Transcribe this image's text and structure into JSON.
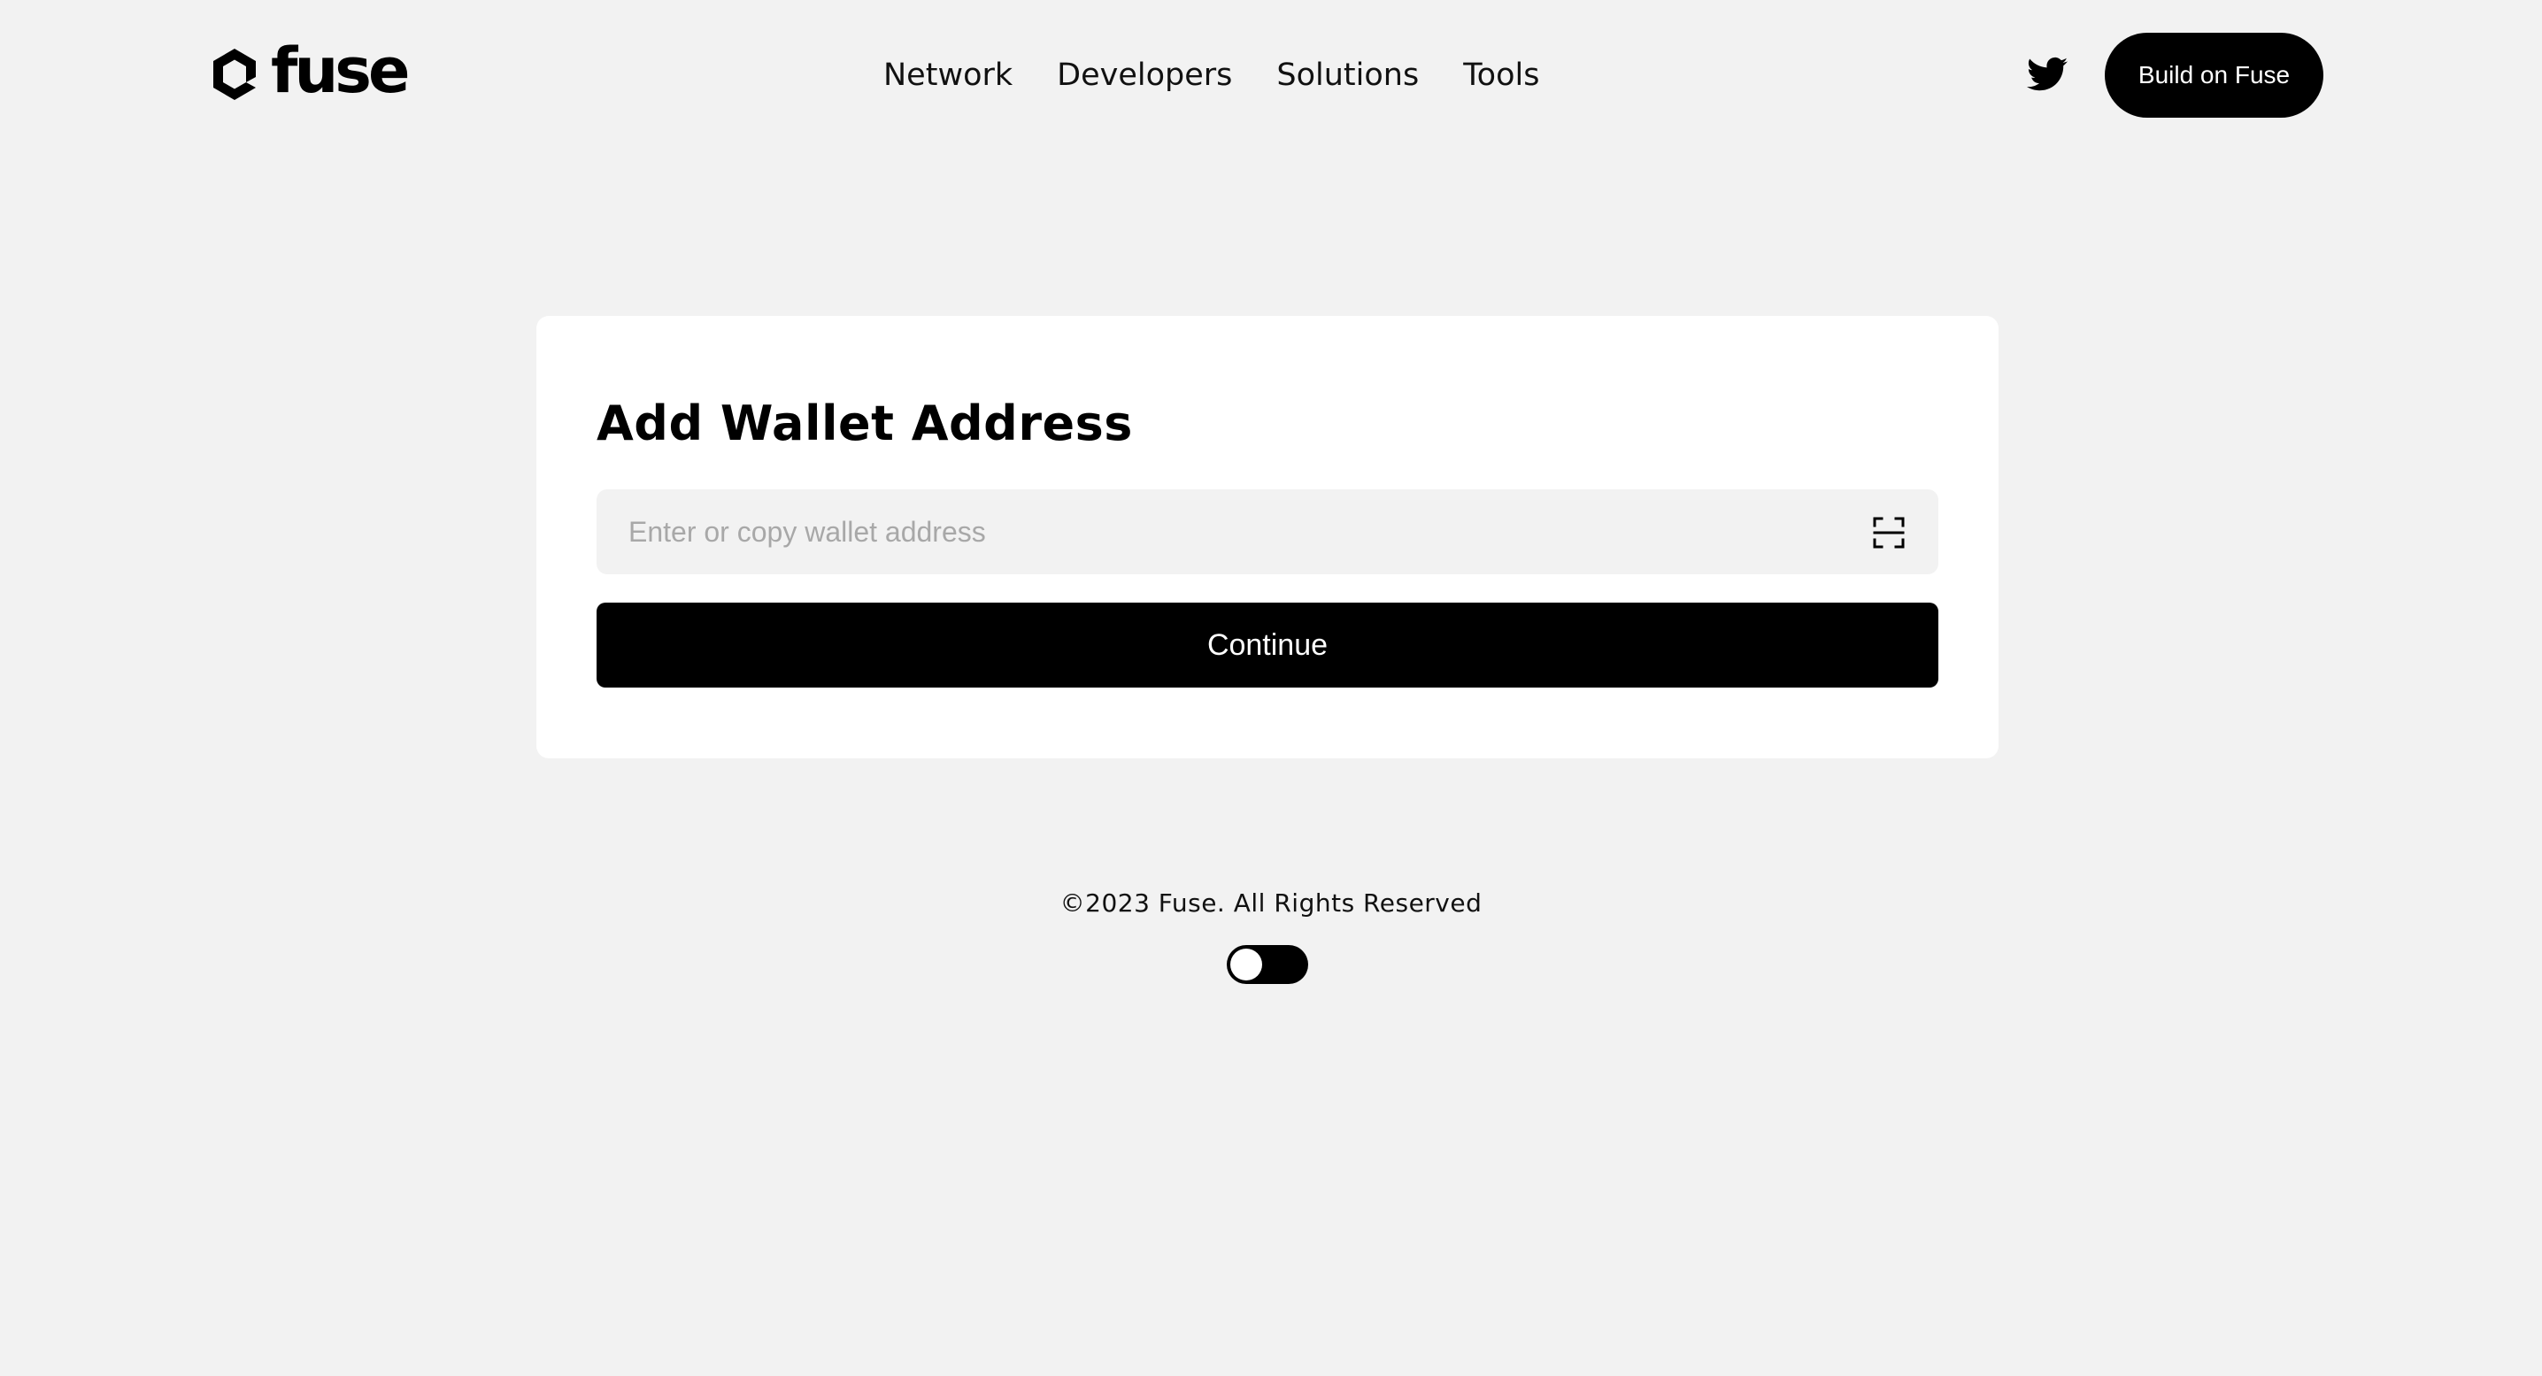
{
  "header": {
    "logo_text": "fuse",
    "nav": [
      {
        "label": "Network"
      },
      {
        "label": "Developers"
      },
      {
        "label": "Solutions"
      },
      {
        "label": "Tools"
      }
    ],
    "social_icon": "twitter-icon",
    "cta_label": "Build on Fuse"
  },
  "card": {
    "title": "Add Wallet Address",
    "address_input": {
      "placeholder": "Enter or copy wallet address",
      "value": ""
    },
    "scan_icon": "scan-icon",
    "continue_label": "Continue"
  },
  "footer": {
    "copyright": "©2023 Fuse. All Rights Reserved",
    "theme_toggle": {
      "state": "off"
    }
  },
  "colors": {
    "background": "#f2f2f2",
    "card": "#ffffff",
    "primary": "#000000",
    "input_bg": "#f2f2f2",
    "placeholder": "#a8a8a8"
  }
}
